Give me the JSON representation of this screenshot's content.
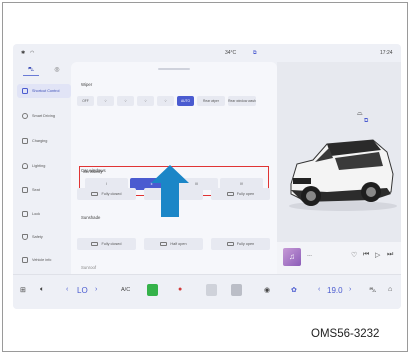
{
  "status": {
    "temperature": "34°C",
    "time": "17:24"
  },
  "sidebar": {
    "items": [
      {
        "label": "Shortcut Control",
        "active": true
      },
      {
        "label": "Smart Driving"
      },
      {
        "label": "Charging"
      },
      {
        "label": "Lighting"
      },
      {
        "label": "Seat"
      },
      {
        "label": "Lock"
      },
      {
        "label": "Safety"
      },
      {
        "label": "Vehicle info"
      }
    ]
  },
  "wiper": {
    "title": "Wiper",
    "off": "OFF",
    "auto": "AUTO",
    "rear_wiper": "Rear wiper",
    "rear_window_wash": "Rear window wash"
  },
  "sensitivity": {
    "title": "Sensitivity",
    "levels": [
      "I",
      "II",
      "III",
      "IV"
    ],
    "selected": "II"
  },
  "car_windows": {
    "title": "Car windows",
    "fully_closed": "Fully closed",
    "fully_open": "Fully open"
  },
  "sunshade": {
    "title": "Sunshade",
    "fully_closed": "Fully closed",
    "half_open": "Half open",
    "fully_open": "Fully open"
  },
  "sunroof": {
    "title": "Sunroof"
  },
  "media": {
    "track": "---"
  },
  "dock": {
    "left_temp": "LO",
    "ac": "A/C",
    "right_temp": "19.0"
  },
  "caption": "OMS56-3232",
  "colors": {
    "accent": "#4a5bd0",
    "highlight_box": "#e03434",
    "arrow": "#1b86c7"
  }
}
